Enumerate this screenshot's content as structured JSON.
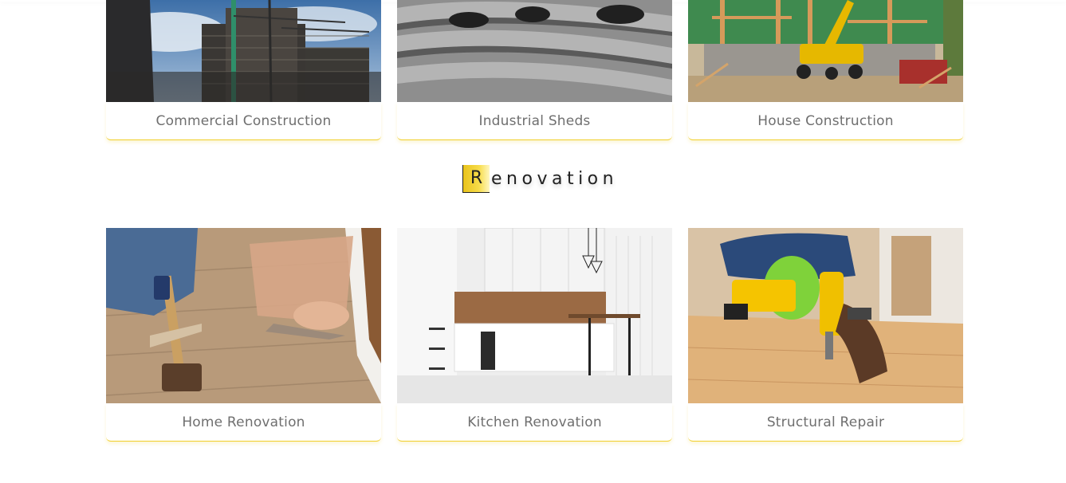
{
  "services_top": [
    {
      "title": "Commercial Construction",
      "image": "commercial-construction-photo"
    },
    {
      "title": "Industrial Sheds",
      "image": "industrial-sheds-photo"
    },
    {
      "title": "House Construction",
      "image": "house-construction-photo"
    }
  ],
  "renovation": {
    "heading_initial": "R",
    "heading_rest": "enovation",
    "items": [
      {
        "title": "Home Renovation",
        "image": "home-renovation-photo"
      },
      {
        "title": "Kitchen Renovation",
        "image": "kitchen-renovation-photo"
      },
      {
        "title": "Structural Repair",
        "image": "structural-repair-photo"
      }
    ]
  },
  "colors": {
    "accent": "#f1cf2a",
    "caption_text": "#6f6f6f",
    "heading_text": "#222222"
  }
}
